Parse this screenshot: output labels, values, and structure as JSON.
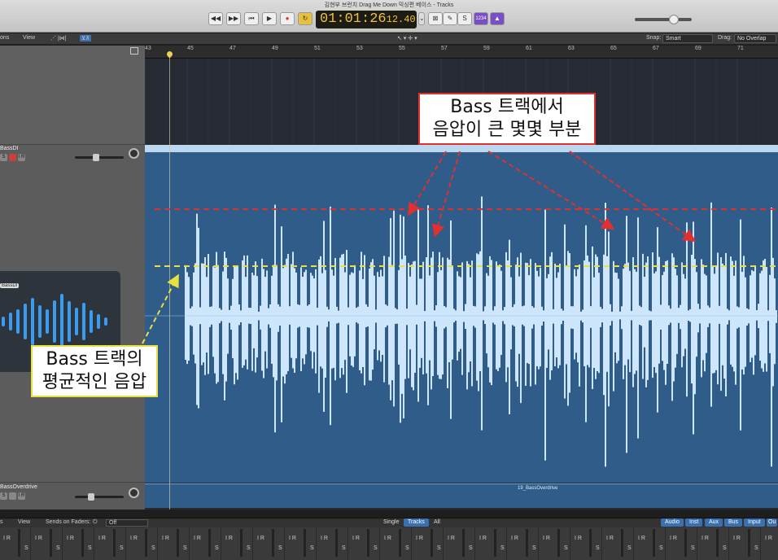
{
  "window": {
    "title": "김현부 브런치 Drag Me Down 믹싱편 베이스 - Tracks"
  },
  "transport": {
    "lcd_main": "01:01:26",
    "lcd_sub": "12.40",
    "rewind": "◀◀",
    "forward": "▶▶",
    "to_start": "⏮",
    "play": "▶",
    "record": "●",
    "cycle": "↻",
    "counter": "1234"
  },
  "toolbar": {
    "functions": "ons",
    "view": "View",
    "snap_label": "Snap:",
    "snap_value": "Smart",
    "drag_label": "Drag:",
    "drag_value": "No Overlap"
  },
  "ruler": {
    "bars": [
      "43",
      "45",
      "47",
      "49",
      "51",
      "53",
      "55",
      "57",
      "59",
      "61",
      "63",
      "65",
      "67",
      "69",
      "71"
    ]
  },
  "tracks": [
    {
      "name": "BassDI",
      "region_label": ""
    },
    {
      "name": "BassOverdrive",
      "region_label": "19_BassOverdrive"
    }
  ],
  "plugin": {
    "tag": "BassDI"
  },
  "callouts": {
    "red_line1": "Bass 트랙에서",
    "red_line2": "음압이 큰 몇몇 부분",
    "yellow_line1": "Bass 트랙의",
    "yellow_line2": "평균적인 음압"
  },
  "mixer": {
    "view": "View",
    "edit": "s",
    "sends_label": "Sends on Faders:",
    "sends_value": "Off",
    "tabs": [
      "Single",
      "Tracks",
      "All"
    ],
    "active_tab": "Tracks",
    "type_tabs": [
      "Audio",
      "Inst",
      "Aux",
      "Bus",
      "Input",
      "Ou"
    ],
    "strip_label": "I R",
    "solo_label": "S",
    "mute_label": "M"
  },
  "colors": {
    "region_blue": "#2f5c88",
    "waveform": "#cde6fb",
    "peak_line": "#e03030",
    "average_line": "#e8e040"
  }
}
